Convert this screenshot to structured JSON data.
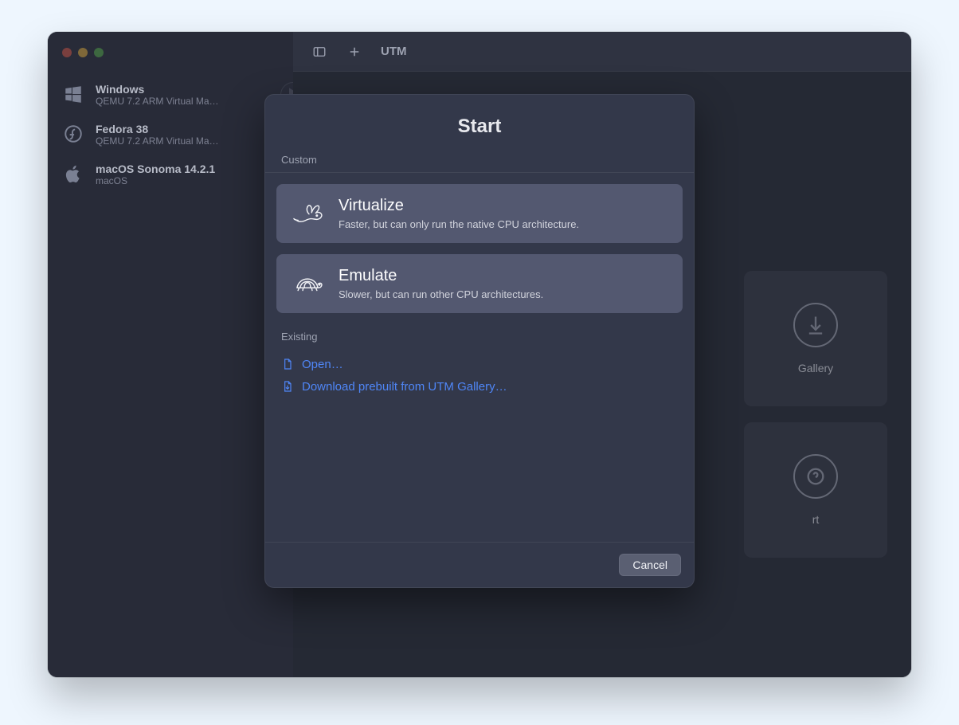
{
  "app_title": "UTM",
  "sidebar": {
    "vms": [
      {
        "name": "Windows",
        "subtitle": "QEMU 7.2 ARM Virtual Ma…",
        "icon": "windows"
      },
      {
        "name": "Fedora 38",
        "subtitle": "QEMU 7.2 ARM Virtual Ma…",
        "icon": "fedora"
      },
      {
        "name": "macOS Sonoma 14.2.1",
        "subtitle": "macOS",
        "icon": "apple"
      }
    ]
  },
  "background_cards": {
    "gallery_label": "Gallery",
    "support_label": "rt"
  },
  "sheet": {
    "title": "Start",
    "section_custom": "Custom",
    "section_existing": "Existing",
    "options": [
      {
        "title": "Virtualize",
        "subtitle": "Faster, but can only run the native CPU architecture."
      },
      {
        "title": "Emulate",
        "subtitle": "Slower, but can run other CPU architectures."
      }
    ],
    "links": {
      "open": "Open…",
      "download": "Download prebuilt from UTM Gallery…"
    },
    "cancel": "Cancel"
  }
}
